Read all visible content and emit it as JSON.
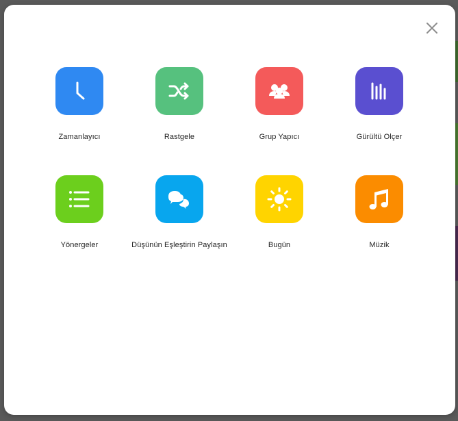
{
  "modal": {
    "close_icon": "close-icon",
    "tools": [
      {
        "id": "timer",
        "label": "Zamanlayıcı",
        "icon": "clock-icon",
        "color": "#2f89f2"
      },
      {
        "id": "random",
        "label": "Rastgele",
        "icon": "shuffle-icon",
        "color": "#56c17e"
      },
      {
        "id": "group-maker",
        "label": "Grup Yapıcı",
        "icon": "group-people-icon",
        "color": "#f45a5a"
      },
      {
        "id": "noise-meter",
        "label": "Gürültü Olçer",
        "icon": "sound-bars-icon",
        "color": "#5a4fd0"
      },
      {
        "id": "directions",
        "label": "Yönergeler",
        "icon": "list-icon",
        "color": "#6ccf1d"
      },
      {
        "id": "think-pair-share",
        "label": "Düşünün Eşleştirin Paylaşın",
        "icon": "speech-bubbles-icon",
        "color": "#08a6ee"
      },
      {
        "id": "today",
        "label": "Bugün",
        "icon": "sun-icon",
        "color": "#ffd400"
      },
      {
        "id": "music",
        "label": "Müzik",
        "icon": "music-note-icon",
        "color": "#fb8c00"
      }
    ]
  }
}
